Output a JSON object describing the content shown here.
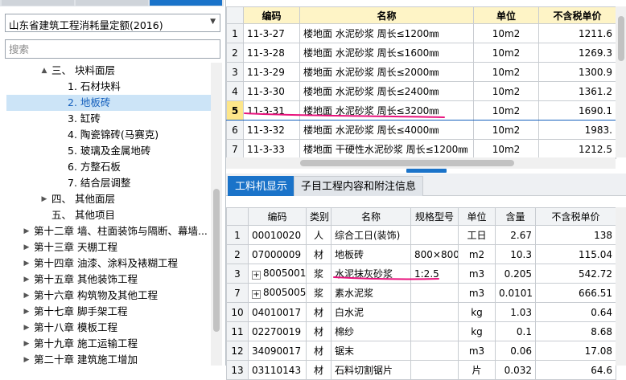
{
  "norm_select": {
    "value": "山东省建筑工程消耗量定额(2016)"
  },
  "search": {
    "placeholder": "搜索"
  },
  "tree": [
    {
      "label": "三、 块料面层",
      "level": 2,
      "arrow": "▲",
      "selected": false
    },
    {
      "label": "1. 石材块料",
      "level": 3,
      "arrow": "",
      "selected": false
    },
    {
      "label": "2. 地板砖",
      "level": 3,
      "arrow": "",
      "selected": true
    },
    {
      "label": "3. 缸砖",
      "level": 3,
      "arrow": "",
      "selected": false
    },
    {
      "label": "4. 陶瓷锦砖(马赛克)",
      "level": 3,
      "arrow": "",
      "selected": false
    },
    {
      "label": "5. 玻璃及金属地砖",
      "level": 3,
      "arrow": "",
      "selected": false
    },
    {
      "label": "6. 方整石板",
      "level": 3,
      "arrow": "",
      "selected": false
    },
    {
      "label": "7. 结合层调整",
      "level": 3,
      "arrow": "",
      "selected": false
    },
    {
      "label": "四、 其他面层",
      "level": 2,
      "arrow": "▶",
      "selected": false
    },
    {
      "label": "五、 其他项目",
      "level": 2,
      "arrow": "",
      "selected": false
    },
    {
      "label": "第十二章 墙、柱面装饰与隔断、幕墙...",
      "level": 1,
      "arrow": "▶",
      "selected": false
    },
    {
      "label": "第十三章 天棚工程",
      "level": 1,
      "arrow": "▶",
      "selected": false
    },
    {
      "label": "第十四章 油漆、涂料及裱糊工程",
      "level": 1,
      "arrow": "▶",
      "selected": false
    },
    {
      "label": "第十五章 其他装饰工程",
      "level": 1,
      "arrow": "▶",
      "selected": false
    },
    {
      "label": "第十六章 构筑物及其他工程",
      "level": 1,
      "arrow": "▶",
      "selected": false
    },
    {
      "label": "第十七章 脚手架工程",
      "level": 1,
      "arrow": "▶",
      "selected": false
    },
    {
      "label": "第十八章 模板工程",
      "level": 1,
      "arrow": "▶",
      "selected": false
    },
    {
      "label": "第十九章 施工运输工程",
      "level": 1,
      "arrow": "▶",
      "selected": false
    },
    {
      "label": "第二十章 建筑施工增加",
      "level": 1,
      "arrow": "▶",
      "selected": false
    }
  ],
  "top_table": {
    "headers": [
      "",
      "编码",
      "名称",
      "单位",
      "不含税单价"
    ],
    "current_row": 4,
    "rows": [
      {
        "idx": "1",
        "code": "11-3-27",
        "name": "楼地面 水泥砂浆 周长≤1200㎜",
        "unit": "10m2",
        "price": "1211.6"
      },
      {
        "idx": "2",
        "code": "11-3-28",
        "name": "楼地面 水泥砂浆 周长≤1600㎜",
        "unit": "10m2",
        "price": "1269.3"
      },
      {
        "idx": "3",
        "code": "11-3-29",
        "name": "楼地面 水泥砂浆 周长≤2000㎜",
        "unit": "10m2",
        "price": "1300.9"
      },
      {
        "idx": "4",
        "code": "11-3-30",
        "name": "楼地面 水泥砂浆 周长≤2400㎜",
        "unit": "10m2",
        "price": "1361.2"
      },
      {
        "idx": "5",
        "code": "11-3-31",
        "name": "楼地面 水泥砂浆 周长≤3200㎜",
        "unit": "10m2",
        "price": "1690.1"
      },
      {
        "idx": "6",
        "code": "11-3-32",
        "name": "楼地面 水泥砂浆 周长≤4000㎜",
        "unit": "10m2",
        "price": "1983."
      },
      {
        "idx": "7",
        "code": "11-3-33",
        "name": "楼地面 干硬性水泥砂浆 周长≤1200㎜",
        "unit": "10m2",
        "price": "1212.5"
      }
    ]
  },
  "bottom_tabs": [
    {
      "label": "工料机显示",
      "active": true
    },
    {
      "label": "子目工程内容和附注信息",
      "active": false
    }
  ],
  "bottom_table": {
    "headers": [
      "",
      "编码",
      "类别",
      "名称",
      "规格型号",
      "单位",
      "含量",
      "不含税单价"
    ],
    "rows": [
      {
        "idx": "1",
        "expand": false,
        "code": "00010020",
        "cat": "人",
        "name": "综合工日(装饰)",
        "spec": "",
        "unit": "工日",
        "qty": "2.67",
        "price": "138"
      },
      {
        "idx": "2",
        "expand": false,
        "code": "07000009",
        "cat": "材",
        "name": "地板砖",
        "spec": "800×800",
        "unit": "m2",
        "qty": "10.3",
        "price": "115.04"
      },
      {
        "idx": "3",
        "expand": true,
        "code": "80050011",
        "cat": "浆",
        "name": "水泥抹灰砂浆",
        "spec": "1:2.5",
        "unit": "m3",
        "qty": "0.205",
        "price": "542.72"
      },
      {
        "idx": "7",
        "expand": true,
        "code": "80050057",
        "cat": "浆",
        "name": "素水泥浆",
        "spec": "",
        "unit": "m3",
        "qty": "0.0101",
        "price": "666.51"
      },
      {
        "idx": "10",
        "expand": false,
        "code": "04010017",
        "cat": "材",
        "name": "白水泥",
        "spec": "",
        "unit": "kg",
        "qty": "1.03",
        "price": "0.64"
      },
      {
        "idx": "11",
        "expand": false,
        "code": "02270019",
        "cat": "材",
        "name": "棉纱",
        "spec": "",
        "unit": "kg",
        "qty": "0.1",
        "price": "8.68"
      },
      {
        "idx": "12",
        "expand": false,
        "code": "34090017",
        "cat": "材",
        "name": "锯末",
        "spec": "",
        "unit": "m3",
        "qty": "0.06",
        "price": "17.08"
      },
      {
        "idx": "13",
        "expand": false,
        "code": "03110143",
        "cat": "材",
        "name": "石料切割锯片",
        "spec": "",
        "unit": "片",
        "qty": "0.032",
        "price": "64.6"
      }
    ]
  },
  "colors": {
    "accent": "#1a73c9",
    "header_yellow": "#fef4c6",
    "selection": "#cce4f7",
    "annotation": "#e8127c"
  }
}
